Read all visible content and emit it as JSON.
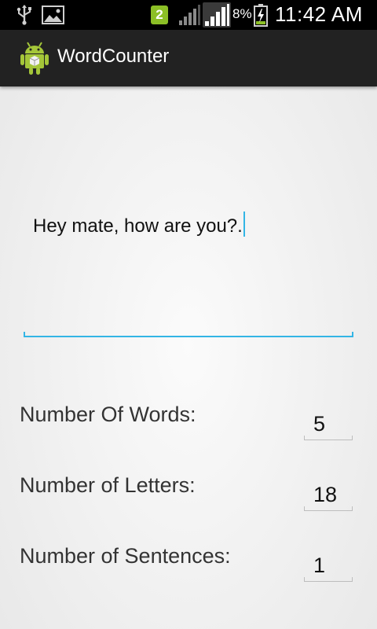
{
  "status_bar": {
    "notification_badge": "2",
    "battery_percent": "8%",
    "time": "11:42 AM",
    "icons": [
      "usb-icon",
      "image-icon",
      "signal-icon",
      "signal-icon",
      "battery-charging-icon"
    ]
  },
  "app": {
    "title": "WordCounter",
    "icon": "android-app-icon"
  },
  "input": {
    "value": "Hey mate, how are you?."
  },
  "stats": [
    {
      "label": "Number Of Words:",
      "value": "5"
    },
    {
      "label": "Number of Letters:",
      "value": "18"
    },
    {
      "label": "Number of Sentences:",
      "value": "1"
    }
  ],
  "colors": {
    "accent": "#33b5e5",
    "action_bar": "#222222",
    "status_bar": "#000000",
    "badge": "#8cbf26"
  }
}
